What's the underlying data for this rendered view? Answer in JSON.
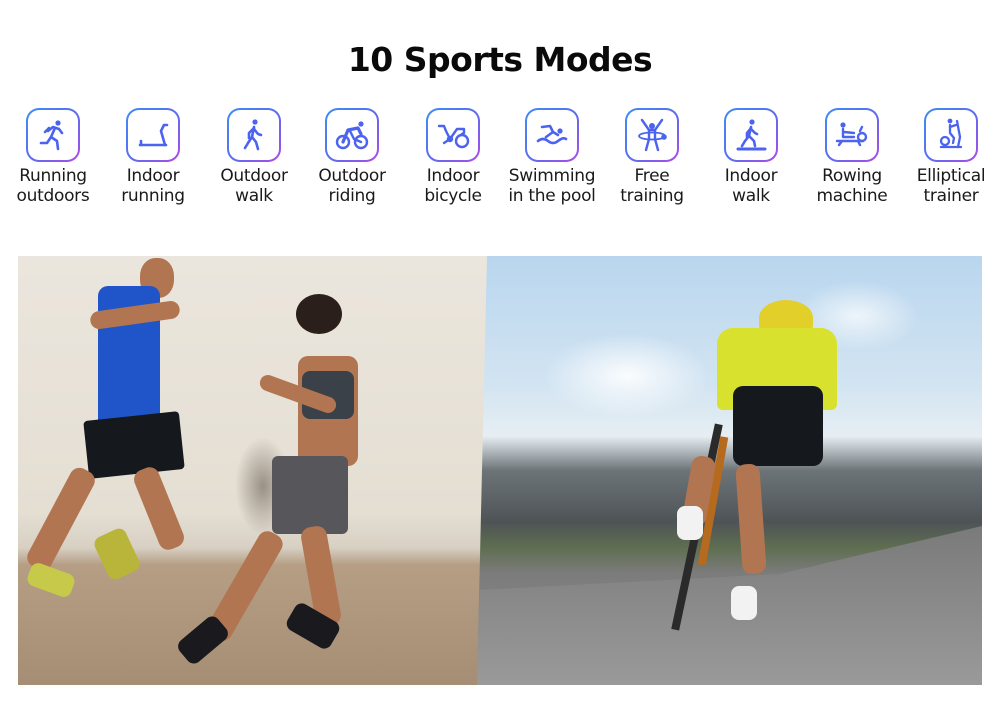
{
  "page": {
    "title": "10 Sports Modes"
  },
  "theme": {
    "icon_gradient_start": "#3e8df5",
    "icon_gradient_end": "#b04ae6",
    "text_color": "#1a1a1a"
  },
  "modes": [
    {
      "icon": "running-outdoors-icon",
      "line1": "Running",
      "line2": "outdoors"
    },
    {
      "icon": "treadmill-icon",
      "line1": "Indoor",
      "line2": "running"
    },
    {
      "icon": "walking-icon",
      "line1": "Outdoor",
      "line2": "walk"
    },
    {
      "icon": "cycling-icon",
      "line1": "Outdoor",
      "line2": "riding"
    },
    {
      "icon": "stationary-bike-icon",
      "line1": "Indoor",
      "line2": "bicycle"
    },
    {
      "icon": "swimming-icon",
      "line1": "Swimming",
      "line2": "in the pool"
    },
    {
      "icon": "hula-hoop-icon",
      "line1": "Free",
      "line2": "training"
    },
    {
      "icon": "treadmill-walk-icon",
      "line1": "Indoor",
      "line2": "walk"
    },
    {
      "icon": "rowing-machine-icon",
      "line1": "Rowing",
      "line2": "machine"
    },
    {
      "icon": "elliptical-trainer-icon",
      "line1": "Elliptical",
      "line2": "trainer"
    }
  ],
  "photos": [
    {
      "subject": "couple running outdoors"
    },
    {
      "subject": "cyclist riding on coastal road"
    }
  ]
}
